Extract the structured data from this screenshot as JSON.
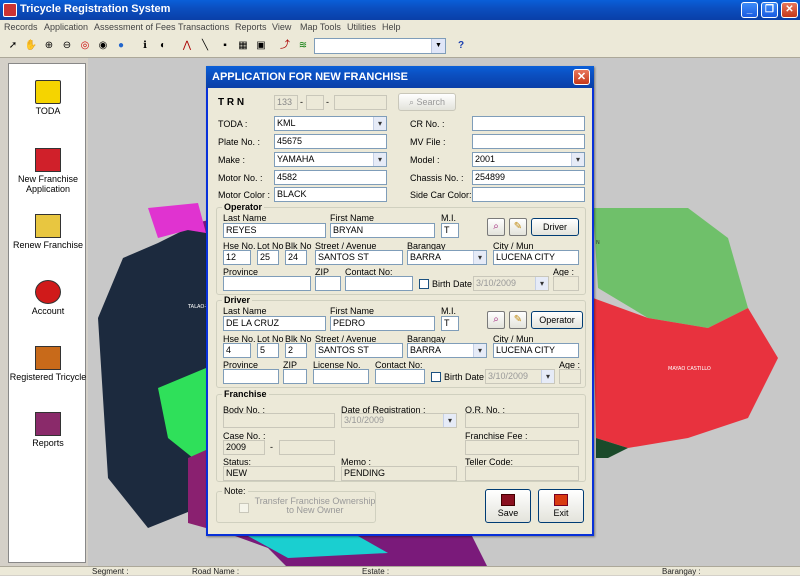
{
  "app": {
    "title": "Tricycle Registration System",
    "window_buttons": {
      "minimize": "_",
      "maximize": "❐",
      "close": "✕"
    }
  },
  "menu": [
    "Records",
    "Application",
    "Assessment of Fees",
    "Transactions",
    "Reports",
    "View",
    "Map Tools",
    "Utilities",
    "Help"
  ],
  "toolbar": {
    "combo_value": "",
    "help_glyph": "?"
  },
  "sidebar": {
    "items": [
      {
        "label": "TODA",
        "icon": "toda-icon"
      },
      {
        "label": "New Franchise Application",
        "icon": "new-franchise-icon"
      },
      {
        "label": "Renew Franchise",
        "icon": "renew-franchise-icon"
      },
      {
        "label": "Account",
        "icon": "account-icon"
      },
      {
        "label": "Registered Tricycle",
        "icon": "registered-tricycle-icon"
      },
      {
        "label": "Reports",
        "icon": "reports-icon"
      }
    ]
  },
  "map": {
    "labels": [
      "TALAO-TAO",
      "MAYAO CASTILLO",
      "N"
    ]
  },
  "status": {
    "segment_label": "Segment :",
    "road_label": "Road Name :",
    "estate_label": "Estate :",
    "barangay_label": "Barangay :"
  },
  "dialog": {
    "title": "APPLICATION FOR NEW FRANCHISE",
    "close": "✕",
    "trn": {
      "label": "T R N",
      "part1": "133",
      "sep": "-",
      "part2": "",
      "part3": "",
      "search_label": "Search"
    },
    "vehicle": {
      "toda_label": "TODA :",
      "toda": "KML",
      "plate_label": "Plate No. :",
      "plate": "45675",
      "make_label": "Make :",
      "make": "YAMAHA",
      "motor_label": "Motor No. :",
      "motor": "4582",
      "color_label": "Motor Color :",
      "color": "BLACK",
      "cr_label": "CR No. :",
      "cr": "",
      "mv_label": "MV File :",
      "mv": "",
      "model_label": "Model :",
      "model": "2001",
      "chassis_label": "Chassis No. :",
      "chassis": "254899",
      "sidecar_label": "Side Car Color:",
      "sidecar": ""
    },
    "operator": {
      "title": "Operator",
      "last_label": "Last Name",
      "last": "REYES",
      "first_label": "First Name",
      "first": "BRYAN",
      "mi_label": "M.I.",
      "mi": "T",
      "button": "Driver",
      "hse_label": "Hse No.",
      "hse": "12",
      "lot_label": "Lot No",
      "lot": "25",
      "blk_label": "Blk No",
      "blk": "24",
      "street_label": "Street / Avenue",
      "street": "SANTOS ST",
      "brgy_label": "Barangay",
      "brgy": "BARRA",
      "city_label": "City / Mun",
      "city": "LUCENA CITY",
      "prov_label": "Province",
      "prov": "",
      "zip_label": "ZIP",
      "zip": "",
      "contact_label": "Contact No:",
      "contact": "",
      "bdate_label": "Birth Date",
      "bdate": "3/10/2009",
      "age_label": "Age :",
      "age": ""
    },
    "driver": {
      "title": "Driver",
      "last_label": "Last Name",
      "last": "DE LA CRUZ",
      "first_label": "First Name",
      "first": "PEDRO",
      "mi_label": "M.I.",
      "mi": "T",
      "button": "Operator",
      "hse_label": "Hse No.",
      "hse": "4",
      "lot_label": "Lot No",
      "lot": "5",
      "blk_label": "Blk No",
      "blk": "2",
      "street_label": "Street / Avenue",
      "street": "SANTOS ST",
      "brgy_label": "Barangay",
      "brgy": "BARRA",
      "city_label": "City / Mun",
      "city": "LUCENA CITY",
      "prov_label": "Province",
      "prov": "",
      "zip_label": "ZIP",
      "zip": "",
      "license_label": "License No.",
      "license": "",
      "contact_label": "Contact No:",
      "contact": "",
      "bdate_label": "Birth Date",
      "bdate": "3/10/2009",
      "age_label": "Age :",
      "age": ""
    },
    "franchise": {
      "title": "Franchise",
      "body_label": "Body No. :",
      "body": "",
      "date_label": "Date of Registration :",
      "date": "3/10/2009",
      "or_label": "O.R. No. :",
      "or": "",
      "case_label": "Case No. :",
      "case1": "2009",
      "case_sep": "-",
      "case2": "",
      "fee_label": "Franchise Fee :",
      "fee": "",
      "status_label": "Status:",
      "status": "NEW",
      "memo_label": "Memo :",
      "memo": "PENDING",
      "teller_label": "Teller Code:",
      "teller": ""
    },
    "note": {
      "title": "Note:",
      "transfer": "Transfer Franchise Ownership to New Owner"
    },
    "save_label": "Save",
    "exit_label": "Exit"
  }
}
